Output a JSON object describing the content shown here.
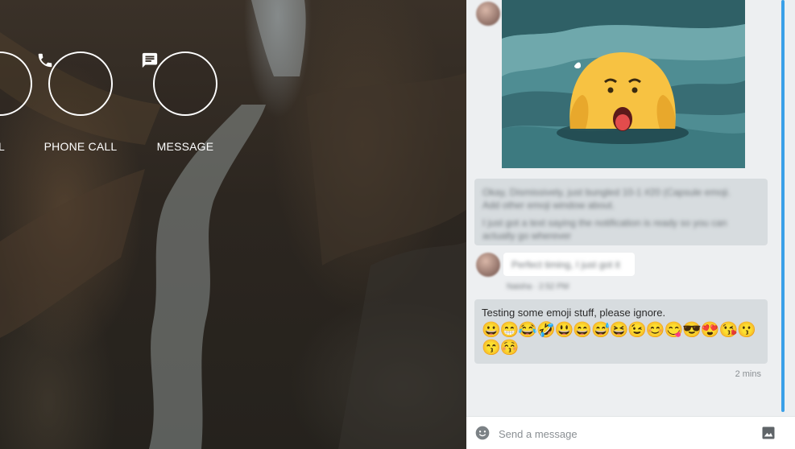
{
  "call_actions": [
    {
      "label": "L",
      "icon": "video-call-icon"
    },
    {
      "label": "PHONE CALL",
      "icon": "phone-icon"
    },
    {
      "label": "MESSAGE",
      "icon": "message-icon"
    }
  ],
  "conversation": {
    "blurred_message": {
      "line1": "Okay, Dismissively, just bungled 10-1 #20 (Capsule emoji.",
      "line2": "Add other emoji window about.",
      "line3": "I just got a text saying the notification is ready so you can",
      "line4": "actually go wherever"
    },
    "blurred_reply": {
      "text": "Perfect timing, I just got it",
      "meta": "Naisha · 2:52 PM"
    },
    "emoji_message": {
      "text": "Testing some emoji stuff, please ignore.",
      "emoji_row1": "😀😁😂🤣😃😄😅😆😉😊😋😎😍😘😗",
      "emoji_row2": "😙😚"
    },
    "timestamp": "2 mins"
  },
  "composer": {
    "placeholder": "Send a message",
    "emoji_icon": "emoji-smile-icon",
    "image_icon": "image-icon"
  },
  "colors": {
    "accent_scrollbar": "#3aa0e8",
    "panel_bg": "#edeff1",
    "bubble_bg": "#d7dcdf",
    "sticker_bg": "#4f8d93",
    "sticker_face": "#f7c242"
  }
}
